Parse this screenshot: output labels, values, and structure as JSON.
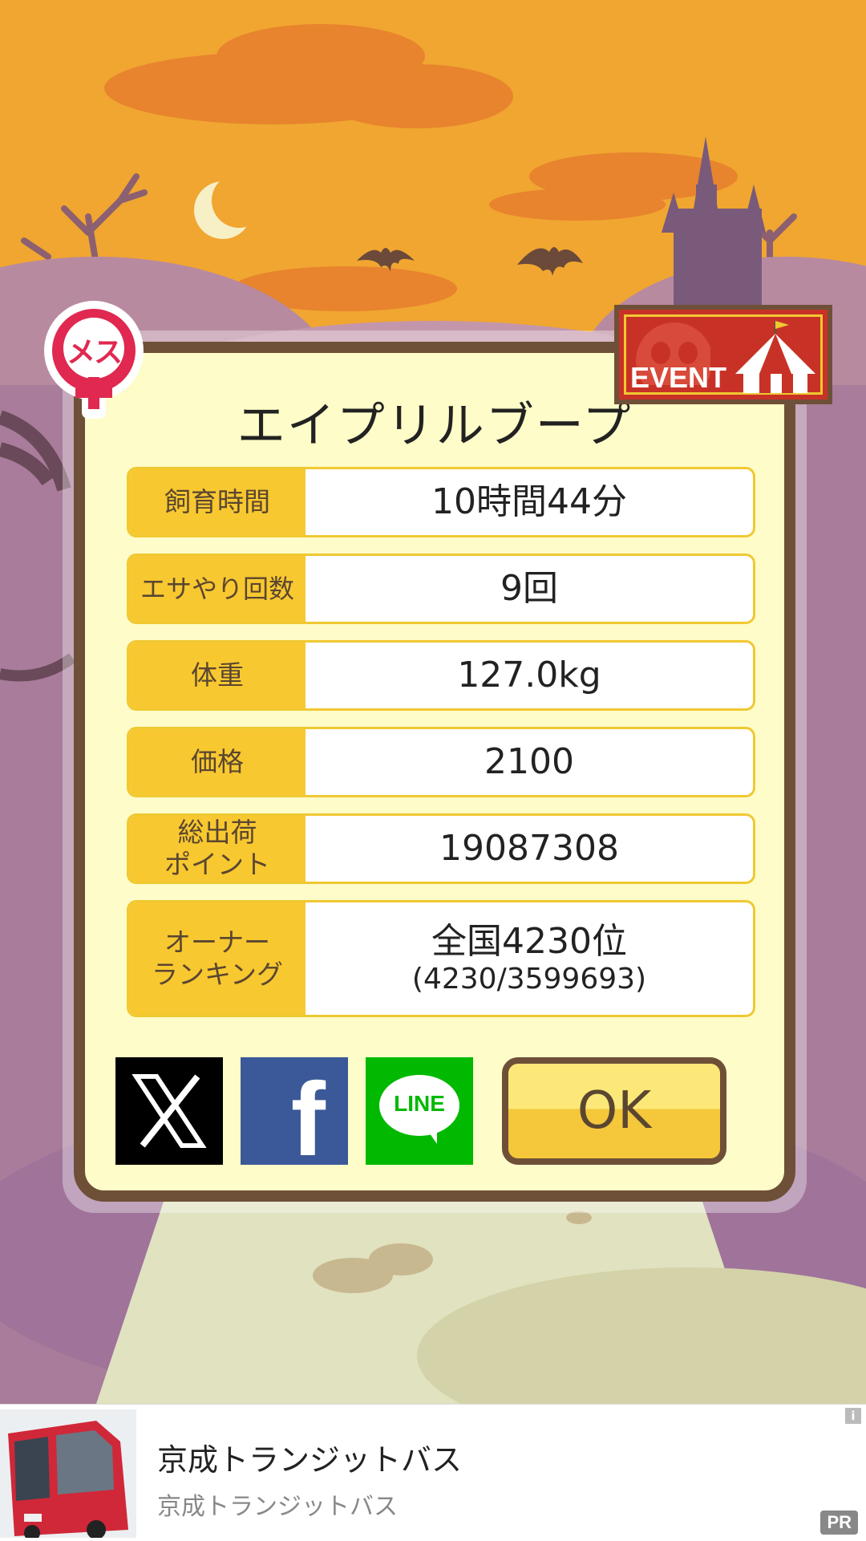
{
  "dialog": {
    "title": "エイプリルブープ",
    "rows": [
      {
        "label": "飼育時間",
        "value": "10時間44分"
      },
      {
        "label": "エサやり回数",
        "value": "9回"
      },
      {
        "label": "体重",
        "value": "127.0kg"
      },
      {
        "label": "価格",
        "value": "2100"
      },
      {
        "label": "総出荷\nポイント",
        "value": "19087308"
      },
      {
        "label": "オーナー\nランキング",
        "value": "全国4230位",
        "sub": "(4230/3599693)"
      }
    ],
    "ok_label": "OK"
  },
  "badges": {
    "gender_label": "メス",
    "event_label": "EVENT"
  },
  "share": {
    "x_icon": "x-icon",
    "facebook_icon": "facebook-icon",
    "line_icon": "line-icon",
    "line_text": "LINE",
    "facebook_text": "f"
  },
  "ad": {
    "title": "京成トランジットバス",
    "subtitle": "京成トランジットバス",
    "info": "i",
    "pr": "PR"
  },
  "colors": {
    "sky": "#f0a630",
    "cloud": "#e8832e",
    "hill": "#a87c9a",
    "panel": "#fefcc8",
    "frame": "#6e5038",
    "label_bg": "#f8c830",
    "ok_top": "#fce878",
    "ok_bottom": "#f4c83a"
  }
}
